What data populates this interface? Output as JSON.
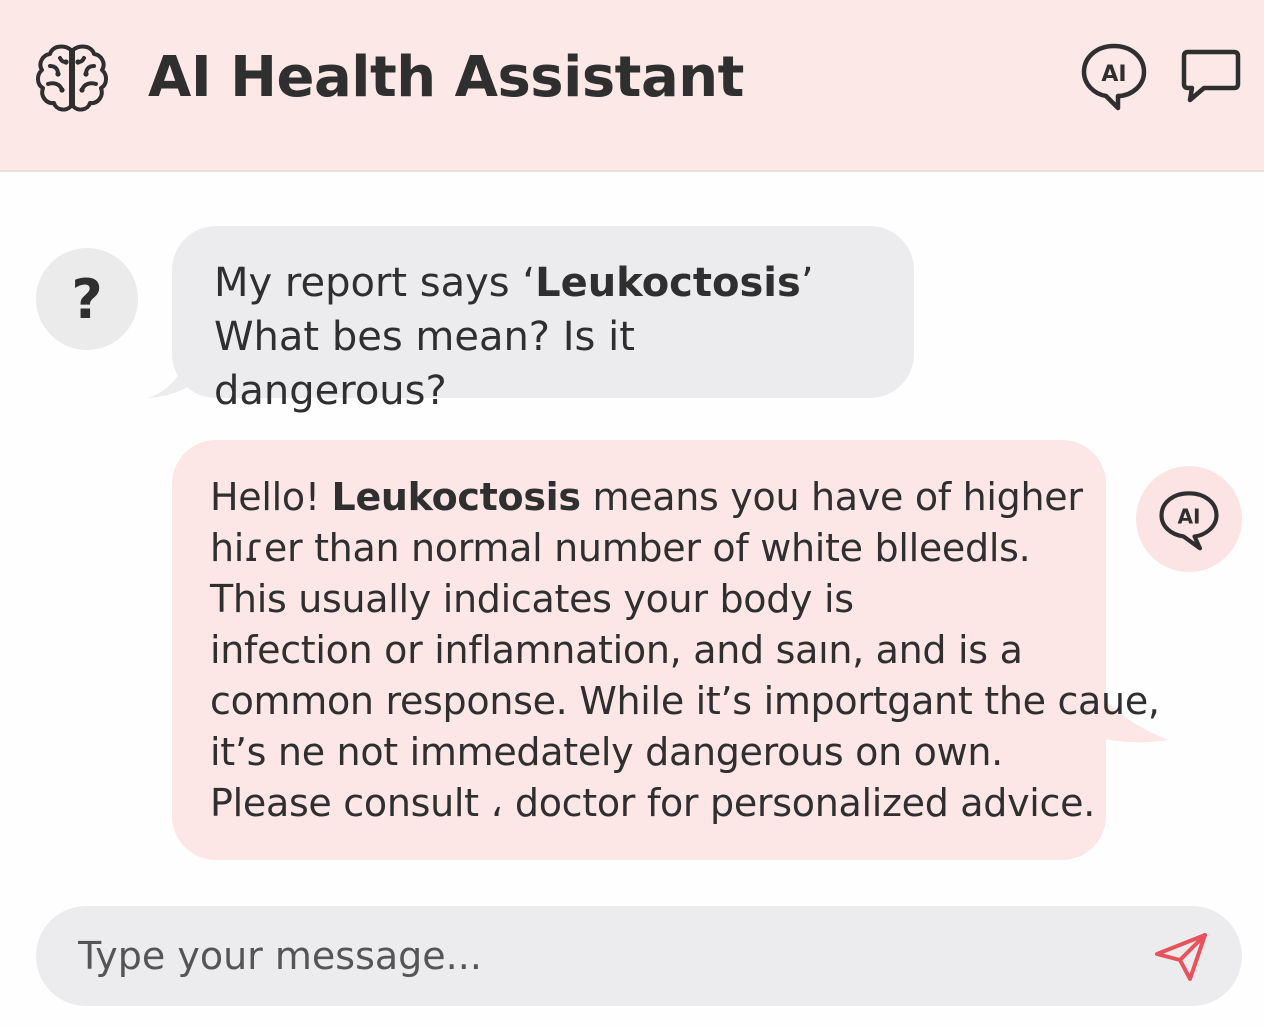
{
  "header": {
    "title": "AI Health Assistant",
    "brain_icon": "brain-icon",
    "ai_icon_label": "AI",
    "chat_icon": "chat-bubble-icon"
  },
  "user_message": {
    "avatar_glyph": "?",
    "line1_prefix": "My report says ‘",
    "line1_bold": "Leukoctosis",
    "line1_suffix": "’",
    "line2": "What bes mean? Is it dangerous?"
  },
  "ai_message": {
    "avatar_label": "AI",
    "line1_prefix": "Hello! ",
    "line1_bold": "Leukoctosis",
    "line1_suffix": " means you have of higher",
    "line2": "hiɾer than normal number of white blleedls.",
    "line3": "This usually indicates your body is",
    "line4": "infection or inflamnation, and saın, and is a",
    "line5": "common response. While it’s importgant the caue,",
    "line6": "it’s ne not immedately dangerous on own.",
    "line7": "Please consult ، doctor for personalized advice."
  },
  "composer": {
    "placeholder": "Type your message...",
    "send_icon": "send-icon"
  },
  "colors": {
    "header_bg": "#fde8e8",
    "user_bubble": "#ececee",
    "ai_bubble": "#fde6e6",
    "send_accent": "#e8525a",
    "text": "#2f2f2f"
  }
}
